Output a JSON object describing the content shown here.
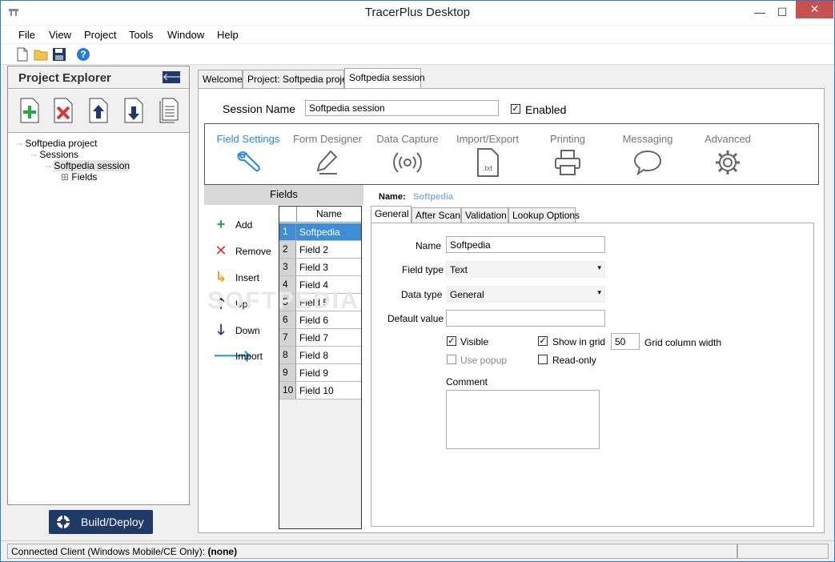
{
  "window": {
    "title": "TracerPlus Desktop",
    "close": "✕",
    "minimize": "—",
    "maximize": "☐"
  },
  "menu": {
    "items": [
      "File",
      "View",
      "Project",
      "Tools",
      "Window",
      "Help"
    ]
  },
  "project_explorer": {
    "title": "Project Explorer",
    "back": "🡐",
    "tree": {
      "project": "Softpedia project",
      "sessions": "Sessions",
      "session": "Softpedia session",
      "fields": "Fields",
      "expander": "⊞"
    }
  },
  "build_button": "Build/Deploy",
  "doc_tabs": [
    "Welcome",
    "Project: Softpedia project",
    "Softpedia session"
  ],
  "session": {
    "name_label": "Session Name",
    "name_value": "Softpedia session",
    "enabled_label": "Enabled",
    "enabled": true
  },
  "ribbon": [
    "Field Settings",
    "Form Designer",
    "Data Capture",
    "Import/Export",
    "Printing",
    "Messaging",
    "Advanced"
  ],
  "ribbon_icon_texts": {
    "import_export": ".txt"
  },
  "fields_panel": {
    "header": "Fields",
    "actions": [
      {
        "label": "Add",
        "icon": "+"
      },
      {
        "label": "Remove",
        "icon": "✕"
      },
      {
        "label": "Insert",
        "icon": "↳"
      },
      {
        "label": "Up",
        "icon": "🡑"
      },
      {
        "label": "Down",
        "icon": "🡓"
      },
      {
        "label": "Import",
        "icon": "🡒"
      }
    ],
    "grid_header": "Name",
    "rows": [
      {
        "n": "1",
        "name": "Softpedia"
      },
      {
        "n": "2",
        "name": "Field 2"
      },
      {
        "n": "3",
        "name": "Field 3"
      },
      {
        "n": "4",
        "name": "Field 4"
      },
      {
        "n": "5",
        "name": "Field 5"
      },
      {
        "n": "6",
        "name": "Field 6"
      },
      {
        "n": "7",
        "name": "Field 7"
      },
      {
        "n": "8",
        "name": "Field 8"
      },
      {
        "n": "9",
        "name": "Field 9"
      },
      {
        "n": "10",
        "name": "Field 10"
      }
    ]
  },
  "field_detail": {
    "name_label": "Name:",
    "name_value": "Softpedia",
    "tabs": [
      "General",
      "After Scan",
      "Validation",
      "Lookup Options"
    ],
    "form": {
      "name_label": "Name",
      "name_value": "Softpedia",
      "field_type_label": "Field type",
      "field_type_value": "Text",
      "data_type_label": "Data type",
      "data_type_value": "General",
      "default_label": "Default value",
      "default_value": "",
      "visible_label": "Visible",
      "visible": true,
      "show_grid_label": "Show in grid",
      "show_grid": true,
      "grid_width_value": "50",
      "grid_width_label": "Grid column width",
      "use_popup_label": "Use popup",
      "use_popup": false,
      "readonly_label": "Read-only",
      "readonly": false,
      "comment_label": "Comment",
      "comment_value": "",
      "check_mark": "✓",
      "dropdown_arrow": "▾"
    }
  },
  "status": {
    "label": "Connected Client (Windows Mobile/CE Only):",
    "value": "(none)"
  },
  "watermark": "SOFTPEDIA",
  "colors": {
    "accent": "#2b8ad8",
    "navy": "#1f3a68",
    "add": "#27a844",
    "remove": "#d9353e",
    "insert": "#f0a030",
    "import": "#2ba0d8"
  }
}
